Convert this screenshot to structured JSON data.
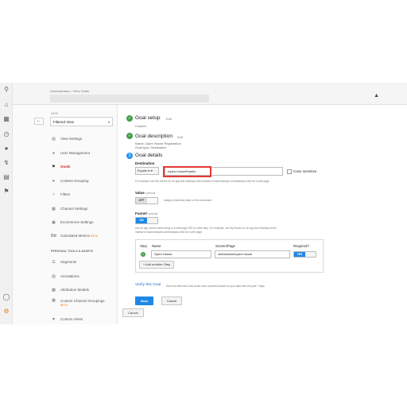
{
  "rail": {
    "icons": [
      "search-icon",
      "home-icon",
      "dashboard-icon",
      "clock-icon",
      "person-icon",
      "share-icon",
      "table-icon",
      "flag-icon",
      "bulb-icon",
      "gear-icon"
    ]
  },
  "topbar": {
    "breadcrumb": "Administration › View Goals"
  },
  "sidebar": {
    "view_label": "VIEW",
    "view_value": "Filtered View",
    "items": [
      {
        "label": "View Settings",
        "icon": "document-icon"
      },
      {
        "label": "User Management",
        "icon": "users-icon"
      },
      {
        "label": "Goals",
        "icon": "flag-icon"
      },
      {
        "label": "Content Grouping",
        "icon": "pointer-icon"
      },
      {
        "label": "Filters",
        "icon": "filter-icon"
      },
      {
        "label": "Channel Settings",
        "icon": "grid-icon"
      },
      {
        "label": "Ecommerce Settings",
        "icon": "cart-icon"
      },
      {
        "label": "Calculated Metrics",
        "beta": "BETA",
        "icon": "calc-icon"
      }
    ],
    "section_title": "PERSONAL TOOLS & ASSETS",
    "tools": [
      {
        "label": "Segments",
        "icon": "segments-icon"
      },
      {
        "label": "Annotations",
        "icon": "notes-icon"
      },
      {
        "label": "Attribution Models",
        "icon": "bars-icon"
      },
      {
        "label": "Custom Channel Groupings",
        "beta": "BETA",
        "icon": "channel-icon"
      },
      {
        "label": "Custom Alerts",
        "icon": "megaphone-icon"
      }
    ]
  },
  "main": {
    "goal_setup": {
      "title": "Goal setup",
      "edit": "Edit",
      "sub": "Custom"
    },
    "goal_description": {
      "title": "Goal description",
      "edit": "Edit",
      "sub1": "Name: Open House Registration",
      "sub2": "Goal type: Destination"
    },
    "goal_details": {
      "step_number": "3",
      "title": "Goal details",
      "destination_label": "Destination",
      "match_type": "Equals to",
      "destination_value": "/open-house/thanks",
      "case_sensitive": "Case sensitive",
      "destination_help": "For example, use My Screen for an app and /thankyou.html instead of www.example.com/thankyou.html for a web page.",
      "value_label": "Value",
      "value_optional": "optional",
      "value_toggle": "OFF",
      "value_help": "Assign a monetary value to the conversion.",
      "funnel_label": "Funnel",
      "funnel_optional": "optional",
      "funnel_toggle": "ON",
      "funnel_help1": "Use an app screen name string or a web page URL for each step. For example, use My Screen for an app and /thankyou.html",
      "funnel_help2": "instead of www.example.com/thankyou.html for a web page.",
      "steps_table": {
        "col_step": "Step",
        "col_name": "Name",
        "col_screen": "Screen/Page",
        "col_required": "Required?",
        "rows": [
          {
            "step": "1",
            "name": "Open House",
            "screen": "/admissions/open-house",
            "required": "YES"
          }
        ],
        "add_step": "+ Add another Step"
      },
      "verify_link": "Verify this Goal",
      "verify_help": "See how often this Goal would have converted based on your data from the past 7 days."
    },
    "save_label": "Save",
    "cancel_label": "Cancel",
    "outer_cancel_label": "Cancel"
  }
}
